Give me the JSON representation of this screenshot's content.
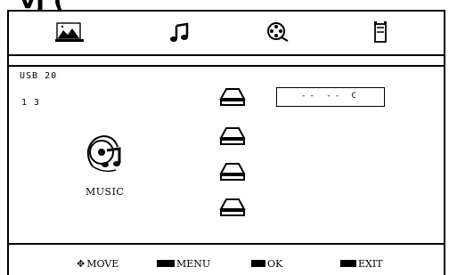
{
  "header": {
    "title": "vj ("
  },
  "menu": {
    "items": [
      {
        "icon": "photo-icon",
        "label": ""
      },
      {
        "icon": "music-note-icon",
        "label": ""
      },
      {
        "icon": "movie-reel-icon",
        "label": ""
      },
      {
        "icon": "file-icon",
        "label": ""
      }
    ]
  },
  "content": {
    "device_label": "USB 20",
    "track_label": "1 3",
    "music_label": "MUSIC",
    "value_display": "-- --  C"
  },
  "footer": {
    "move_label": "MOVE",
    "menu_label": "MENU",
    "ok_label": "OK",
    "exit_label": "EXIT"
  }
}
